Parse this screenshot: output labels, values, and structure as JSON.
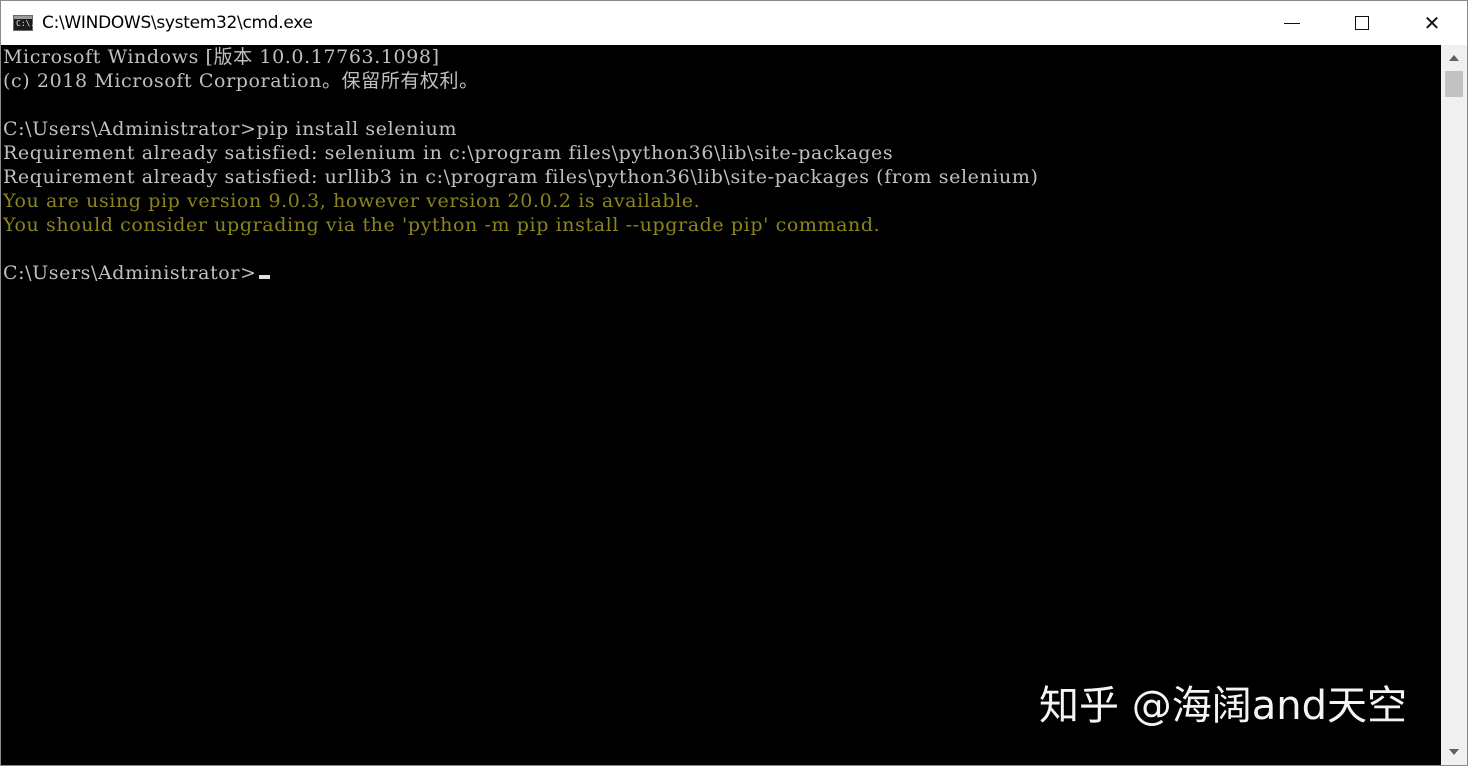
{
  "window": {
    "title": "C:\\WINDOWS\\system32\\cmd.exe",
    "app_icon_text": "C:\\."
  },
  "controls": {
    "close_glyph": "✕"
  },
  "console": {
    "lines": [
      {
        "text": "Microsoft Windows [版本 10.0.17763.1098]",
        "color": "#c0c0c0"
      },
      {
        "text": "(c) 2018 Microsoft Corporation。保留所有权利。",
        "color": "#c0c0c0"
      },
      {
        "text": "",
        "color": "#c0c0c0"
      },
      {
        "text": "C:\\Users\\Administrator>pip install selenium",
        "color": "#c0c0c0"
      },
      {
        "text": "Requirement already satisfied: selenium in c:\\program files\\python36\\lib\\site-packages",
        "color": "#c0c0c0"
      },
      {
        "text": "Requirement already satisfied: urllib3 in c:\\program files\\python36\\lib\\site-packages (from selenium)",
        "color": "#c0c0c0"
      },
      {
        "text": "You are using pip version 9.0.3, however version 20.0.2 is available.",
        "color": "#8a8520"
      },
      {
        "text": "You should consider upgrading via the 'python -m pip install --upgrade pip' command.",
        "color": "#8a8520"
      },
      {
        "text": "",
        "color": "#c0c0c0"
      }
    ],
    "prompt": "C:\\Users\\Administrator>"
  },
  "watermark": {
    "text": "知乎 @海阔and天空"
  }
}
